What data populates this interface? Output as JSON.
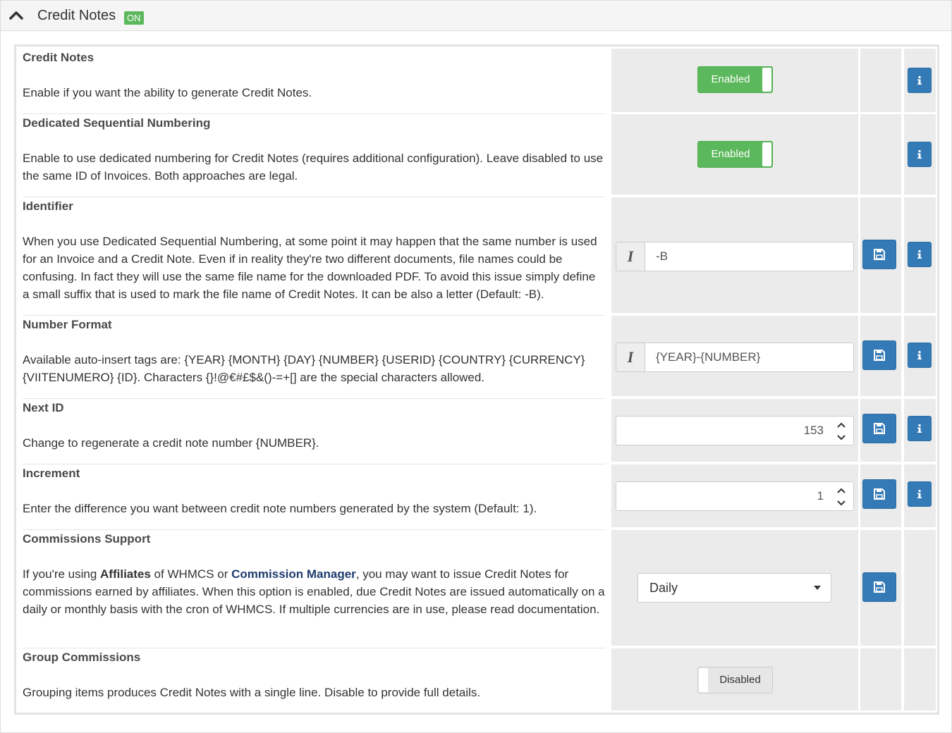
{
  "header": {
    "title": "Credit Notes",
    "badge": "ON"
  },
  "settings": [
    {
      "title": "Credit Notes",
      "description": "Enable if you want the ability to generate Credit Notes.",
      "control": {
        "type": "toggle",
        "state": "Enabled"
      }
    },
    {
      "title": "Dedicated Sequential Numbering",
      "description": "Enable to use dedicated numbering for Credit Notes (requires additional configuration). Leave disabled to use the same ID of Invoices. Both approaches are legal.",
      "control": {
        "type": "toggle",
        "state": "Enabled"
      }
    },
    {
      "title": "Identifier",
      "description": "When you use Dedicated Sequential Numbering, at some point it may happen that the same number is used for an Invoice and a Credit Note. Even if in reality they're two different documents, file names could be confusing. In fact they will use the same file name for the downloaded PDF. To avoid this issue simply define a small suffix that is used to mark the file name of Credit Notes. It can be also a letter (Default: -B).",
      "control": {
        "type": "text",
        "addon": "I",
        "value": "-B"
      }
    },
    {
      "title": "Number Format",
      "description": "Available auto-insert tags are: {YEAR} {MONTH} {DAY} {NUMBER} {USERID} {COUNTRY} {CURRENCY} {VIITENUMERO} {ID}. Characters {}!@€#£$&()-=+[] are the special characters allowed.",
      "control": {
        "type": "text",
        "addon": "I",
        "value": "{YEAR}-{NUMBER}"
      }
    },
    {
      "title": "Next ID",
      "description": "Change to regenerate a credit note number {NUMBER}.",
      "control": {
        "type": "number",
        "value": "153"
      }
    },
    {
      "title": "Increment",
      "description": "Enter the difference you want between credit note numbers generated by the system (Default: 1).",
      "control": {
        "type": "number",
        "value": "1"
      }
    },
    {
      "title": "Commissions Support",
      "description_parts": {
        "p1": "If you're using ",
        "b1": "Affiliates",
        "p2": " of WHMCS or ",
        "b2": "Commission Manager",
        "p3": ", you may want to issue Credit Notes for commissions earned by affiliates. When this option is enabled, due Credit Notes are issued automatically on a daily or monthly basis with the cron of WHMCS. If multiple currencies are in use, please read documentation."
      },
      "control": {
        "type": "select",
        "value": "Daily"
      }
    },
    {
      "title": "Group Commissions",
      "description": "Grouping items produces Credit Notes with a single line. Disable to provide full details.",
      "control": {
        "type": "toggle",
        "state": "Disabled"
      }
    }
  ],
  "colors": {
    "enabled": "#5cb85c",
    "primary": "#337ab7",
    "cell": "#ebebeb"
  },
  "icons": {
    "collapse": "chevron-up-icon",
    "info": "info-icon",
    "save": "floppy-disk-icon",
    "addon": "italic-i-icon",
    "spinner": "up-down-arrows-icon",
    "caret": "caret-down-icon"
  }
}
